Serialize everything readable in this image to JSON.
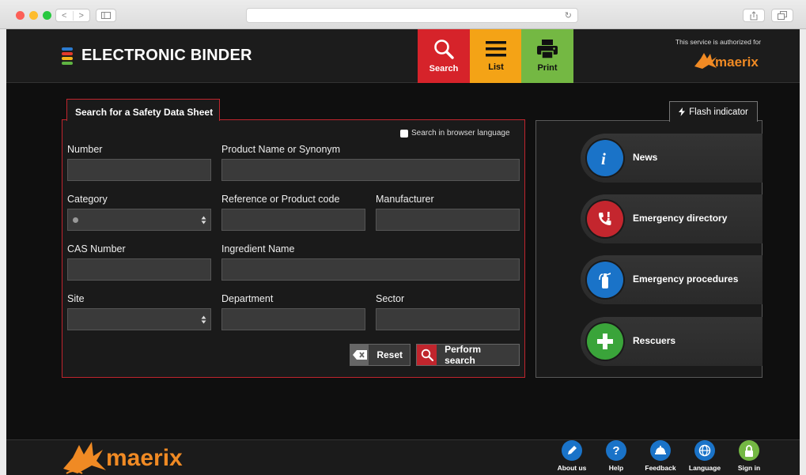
{
  "browser": {
    "nav_back": "<",
    "nav_forward": ">",
    "reload_icon": "↻"
  },
  "app": {
    "title": "ELECTRONIC BINDER",
    "toolbar": {
      "search_label": "Search",
      "list_label": "List",
      "print_label": "Print"
    },
    "authorized_text": "This service is authorized for",
    "brand_logo_text": "maerix"
  },
  "search_form": {
    "tab_label": "Search for a Safety Data Sheet",
    "browser_language_label": "Search in browser language",
    "browser_language_checked": false,
    "fields": {
      "number": {
        "label": "Number",
        "value": ""
      },
      "product_name": {
        "label": "Product Name or Synonym",
        "value": ""
      },
      "category": {
        "label": "Category",
        "value": ""
      },
      "reference": {
        "label": "Reference or Product code",
        "value": ""
      },
      "manufacturer": {
        "label": "Manufacturer",
        "value": ""
      },
      "cas_number": {
        "label": "CAS Number",
        "value": ""
      },
      "ingredient_name": {
        "label": "Ingredient Name",
        "value": ""
      },
      "site": {
        "label": "Site",
        "value": ""
      },
      "department": {
        "label": "Department",
        "value": ""
      },
      "sector": {
        "label": "Sector",
        "value": ""
      }
    },
    "reset_label": "Reset",
    "perform_search_label": "Perform search"
  },
  "flash": {
    "tab_label": "Flash indicator",
    "items": [
      {
        "label": "News",
        "icon": "info-icon",
        "color": "#1a73c8"
      },
      {
        "label": "Emergency directory",
        "icon": "emergency-phone-icon",
        "color": "#c4262e"
      },
      {
        "label": "Emergency procedures",
        "icon": "fire-extinguisher-icon",
        "color": "#1a73c8"
      },
      {
        "label": "Rescuers",
        "icon": "first-aid-cross-icon",
        "color": "#3aa43a"
      }
    ]
  },
  "footer": {
    "logo_text": "maerix",
    "links": [
      {
        "label": "About us",
        "icon": "pen-icon",
        "color": "#1a73c8"
      },
      {
        "label": "Help",
        "icon": "question-icon",
        "color": "#1a73c8"
      },
      {
        "label": "Feedback",
        "icon": "bell-icon",
        "color": "#1a73c8"
      },
      {
        "label": "Language",
        "icon": "globe-icon",
        "color": "#1a73c8"
      },
      {
        "label": "Sign in",
        "icon": "lock-icon",
        "color": "#74b843"
      }
    ]
  },
  "colors": {
    "accent_red": "#c0252d",
    "toolbar_search": "#d6232a",
    "toolbar_list": "#f4a316",
    "toolbar_print": "#74b843",
    "logo_orange": "#f08a24"
  }
}
